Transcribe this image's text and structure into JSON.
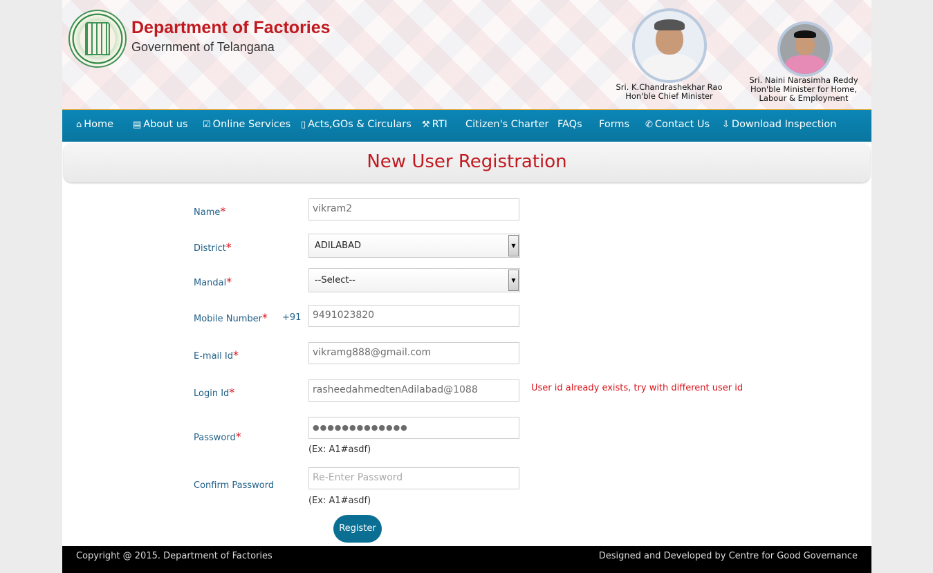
{
  "header": {
    "title": "Department of Factories",
    "subtitle": "Government of Telangana",
    "person1_name": "Sri. K.Chandrashekhar Rao",
    "person1_role": "Hon'ble Chief Minister",
    "person2_name": "Sri. Naini Narasimha Reddy",
    "person2_role_line1": "Hon'ble Minister for Home,",
    "person2_role_line2": "Labour & Employment"
  },
  "nav": {
    "items": [
      {
        "icon": "home-icon",
        "glyph": "⌂",
        "label": "Home"
      },
      {
        "icon": "book-icon",
        "glyph": "▤",
        "label": "About us"
      },
      {
        "icon": "check-square-icon",
        "glyph": "☑",
        "label": "Online Services"
      },
      {
        "icon": "file-icon",
        "glyph": "▯",
        "label": "Acts,GOs & Circulars"
      },
      {
        "icon": "gavel-icon",
        "glyph": "⚒",
        "label": "RTI"
      },
      {
        "icon": "",
        "glyph": "",
        "label": "Citizen's Charter"
      },
      {
        "icon": "",
        "glyph": "",
        "label": "FAQs"
      },
      {
        "icon": "",
        "glyph": "",
        "label": "Forms"
      },
      {
        "icon": "phone-icon",
        "glyph": "✆",
        "label": "Contact Us"
      },
      {
        "icon": "download-icon",
        "glyph": "⇩",
        "label": "Download Inspection"
      }
    ]
  },
  "page_title": "New User Registration",
  "form": {
    "required_mark": "*",
    "name_label": "Name",
    "name_value": "vikram2",
    "district_label": "District",
    "district_value": "ADILABAD",
    "mandal_label": "Mandal",
    "mandal_value": "--Select--",
    "mobile_label": "Mobile Number",
    "mobile_prefix": "+91",
    "mobile_value": "9491023820",
    "email_label": "E-mail Id",
    "email_value": "vikramg888@gmail.com",
    "login_label": "Login Id",
    "login_value": "rasheedahmedtenAdilabad@1088",
    "login_error": "User id already exists, try with different user id",
    "password_label": "Password",
    "password_value": "●●●●●●●●●●●●●",
    "password_hint": "(Ex: A1#asdf)",
    "confirm_label": "Confirm Password",
    "confirm_placeholder": "Re-Enter Password",
    "confirm_hint": "(Ex: A1#asdf)",
    "register_label": "Register"
  },
  "footer": {
    "copyright": "Copyright @ 2015. Department of Factories",
    "credit": "Designed and Developed by Centre for Good Governance"
  },
  "colors": {
    "nav_bg": "#0a7fae",
    "title_red": "#c0191f",
    "label_blue": "#1f5f87",
    "button": "#0b6f93"
  }
}
